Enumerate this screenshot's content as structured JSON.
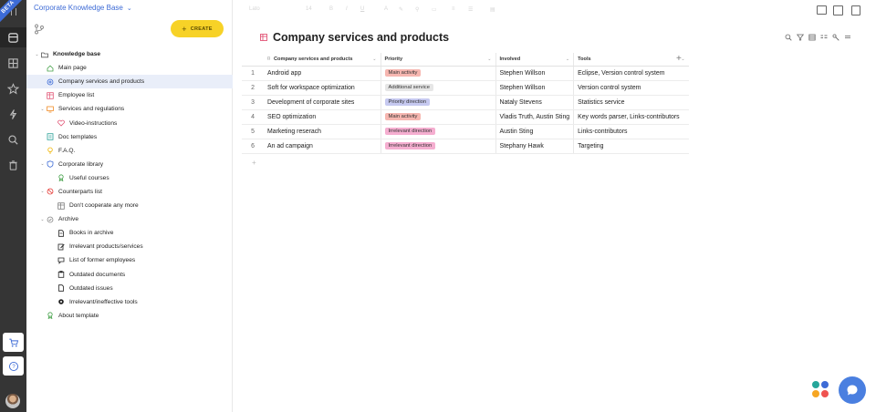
{
  "app": {
    "badge": "BETA",
    "workspace_title": "Corporate Knowledge Base",
    "create_label": "CREATE"
  },
  "toolbar": {
    "font_size_dim": "Lato",
    "font_size2_dim": "14"
  },
  "tree": [
    {
      "label": "Knowledge base",
      "icon": "folder-open-icon",
      "level": 0,
      "caret": "open",
      "root": true
    },
    {
      "label": "Main page",
      "icon": "home-icon",
      "level": 1,
      "color": "#43a047"
    },
    {
      "label": "Company services and products",
      "icon": "settings-circle-icon",
      "level": 1,
      "color": "#3d6bd6",
      "selected": true
    },
    {
      "label": "Employee list",
      "icon": "table-icon",
      "level": 1,
      "color": "#e25576"
    },
    {
      "label": "Services and regulations",
      "icon": "monitor-icon",
      "level": 1,
      "caret": "open",
      "color": "#f08a24"
    },
    {
      "label": "Video-instructions",
      "icon": "heart-icon",
      "level": 2,
      "color": "#e25576"
    },
    {
      "label": "Doc templates",
      "icon": "doc-grid-icon",
      "level": 1,
      "color": "#2aa198"
    },
    {
      "label": "F.A.Q.",
      "icon": "bulb-icon",
      "level": 1,
      "color": "#f0b400"
    },
    {
      "label": "Corporate library",
      "icon": "shield-icon",
      "level": 1,
      "caret": "open",
      "color": "#3d6bd6"
    },
    {
      "label": "Useful courses",
      "icon": "award-icon",
      "level": 2,
      "color": "#43a047"
    },
    {
      "label": "Counterparts list",
      "icon": "block-icon",
      "level": 1,
      "caret": "open",
      "color": "#e53935"
    },
    {
      "label": "Don't cooperate any more",
      "icon": "table-icon",
      "level": 2,
      "color": "#777777"
    },
    {
      "label": "Archive",
      "icon": "archive-icon",
      "level": 1,
      "caret": "open",
      "color": "#888888"
    },
    {
      "label": "Books in archive",
      "icon": "doc-icon",
      "level": 2,
      "color": "#222222"
    },
    {
      "label": "Irrelevant products/services",
      "icon": "edit-doc-icon",
      "level": 2,
      "color": "#222222"
    },
    {
      "label": "List of former employees",
      "icon": "chat-icon",
      "level": 2,
      "color": "#222222"
    },
    {
      "label": "Outdated documents",
      "icon": "clipboard-icon",
      "level": 2,
      "color": "#222222"
    },
    {
      "label": "Outdated issues",
      "icon": "file-icon",
      "level": 2,
      "color": "#222222"
    },
    {
      "label": "Irrelevant/ineffective tools",
      "icon": "gear-icon",
      "level": 2,
      "color": "#222222"
    },
    {
      "label": "About template",
      "icon": "award-icon",
      "level": 1,
      "color": "#43a047"
    }
  ],
  "page": {
    "title": "Company services and products"
  },
  "table": {
    "columns": [
      "Company services and products",
      "Priority",
      "Involved",
      "Tools"
    ],
    "rows": [
      {
        "n": "1",
        "name": "Android app",
        "priority": "Main activity",
        "priority_color": "#f6b6b0",
        "involved": "Stephen Willson",
        "tools": "Eclipse,  Version control system"
      },
      {
        "n": "2",
        "name": "Soft for workspace optimization",
        "priority": "Additional service",
        "priority_color": "#e6e6e6",
        "involved": "Stephen Willson",
        "tools": "Version control system"
      },
      {
        "n": "3",
        "name": "Development of corporate sites",
        "priority": "Priority direction",
        "priority_color": "#c6c9f0",
        "involved": "Nataly Stevens",
        "tools": "Statistics service"
      },
      {
        "n": "4",
        "name": "SEO optimization",
        "priority": "Main activity",
        "priority_color": "#f6b6b0",
        "involved": "Vladis Truth,  Austin Sting",
        "tools": "Key words parser,  Links-contributors"
      },
      {
        "n": "5",
        "name": "Marketing reserach",
        "priority": "Irrelevant direction",
        "priority_color": "#f5aed0",
        "involved": "Austin Sting",
        "tools": "Links-contributors"
      },
      {
        "n": "6",
        "name": "An ad campaign",
        "priority": "Irrelevant direction",
        "priority_color": "#f5aed0",
        "involved": "Stephany Hawk",
        "tools": "Targeting"
      }
    ],
    "add_column": "+",
    "add_row": "+"
  },
  "colors": {
    "accent": "#3d6bd6",
    "create": "#f7d227",
    "rail": "#353535"
  }
}
